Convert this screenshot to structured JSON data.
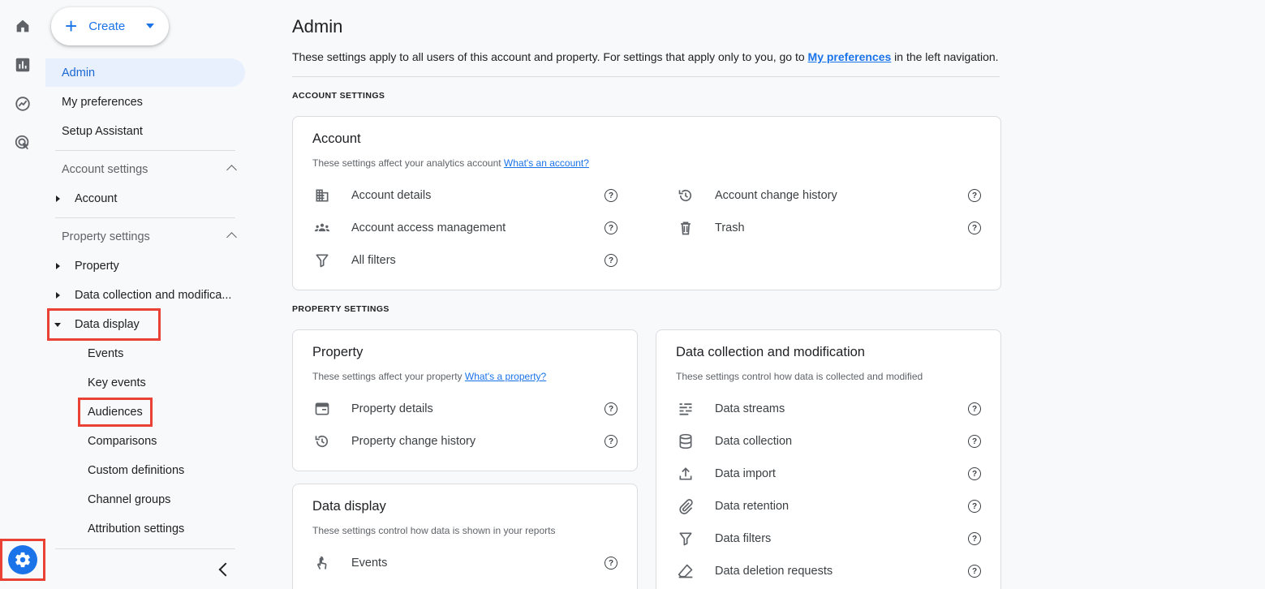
{
  "rail": {
    "icons": [
      "home-icon",
      "reports-icon",
      "explore-icon",
      "advertising-icon"
    ],
    "admin_icon": "gear-icon"
  },
  "nav": {
    "create_label": "Create",
    "admin": "Admin",
    "my_preferences": "My preferences",
    "setup_assistant": "Setup Assistant",
    "account_settings": "Account settings",
    "account": "Account",
    "property_settings": "Property settings",
    "property": "Property",
    "data_collection": "Data collection and modifica...",
    "data_display": "Data display",
    "data_display_children": [
      "Events",
      "Key events",
      "Audiences",
      "Comparisons",
      "Custom definitions",
      "Channel groups",
      "Attribution settings"
    ]
  },
  "main": {
    "title": "Admin",
    "desc_before": "These settings apply to all users of this account and property. For settings that apply only to you, go to ",
    "desc_link": "My preferences",
    "desc_after": " in the left navigation.",
    "account_settings_caps": "ACCOUNT SETTINGS",
    "property_settings_caps": "PROPERTY SETTINGS",
    "account_card": {
      "title": "Account",
      "desc": "These settings affect your analytics account ",
      "link": "What's an account?",
      "left": [
        "Account details",
        "Account access management",
        "All filters"
      ],
      "right": [
        "Account change history",
        "Trash"
      ]
    },
    "property_card": {
      "title": "Property",
      "desc": "These settings affect your property ",
      "link": "What's a property?",
      "items": [
        "Property details",
        "Property change history"
      ]
    },
    "data_display_card": {
      "title": "Data display",
      "desc": "These settings control how data is shown in your reports",
      "items": [
        "Events"
      ]
    },
    "data_collection_card": {
      "title": "Data collection and modification",
      "desc": "These settings control how data is collected and modified",
      "items": [
        "Data streams",
        "Data collection",
        "Data import",
        "Data retention",
        "Data filters",
        "Data deletion requests"
      ]
    },
    "help_glyph": "?"
  },
  "colors": {
    "accent": "#1a73e8",
    "highlight_box": "#e94235",
    "active_bg": "#e8f0fe"
  }
}
